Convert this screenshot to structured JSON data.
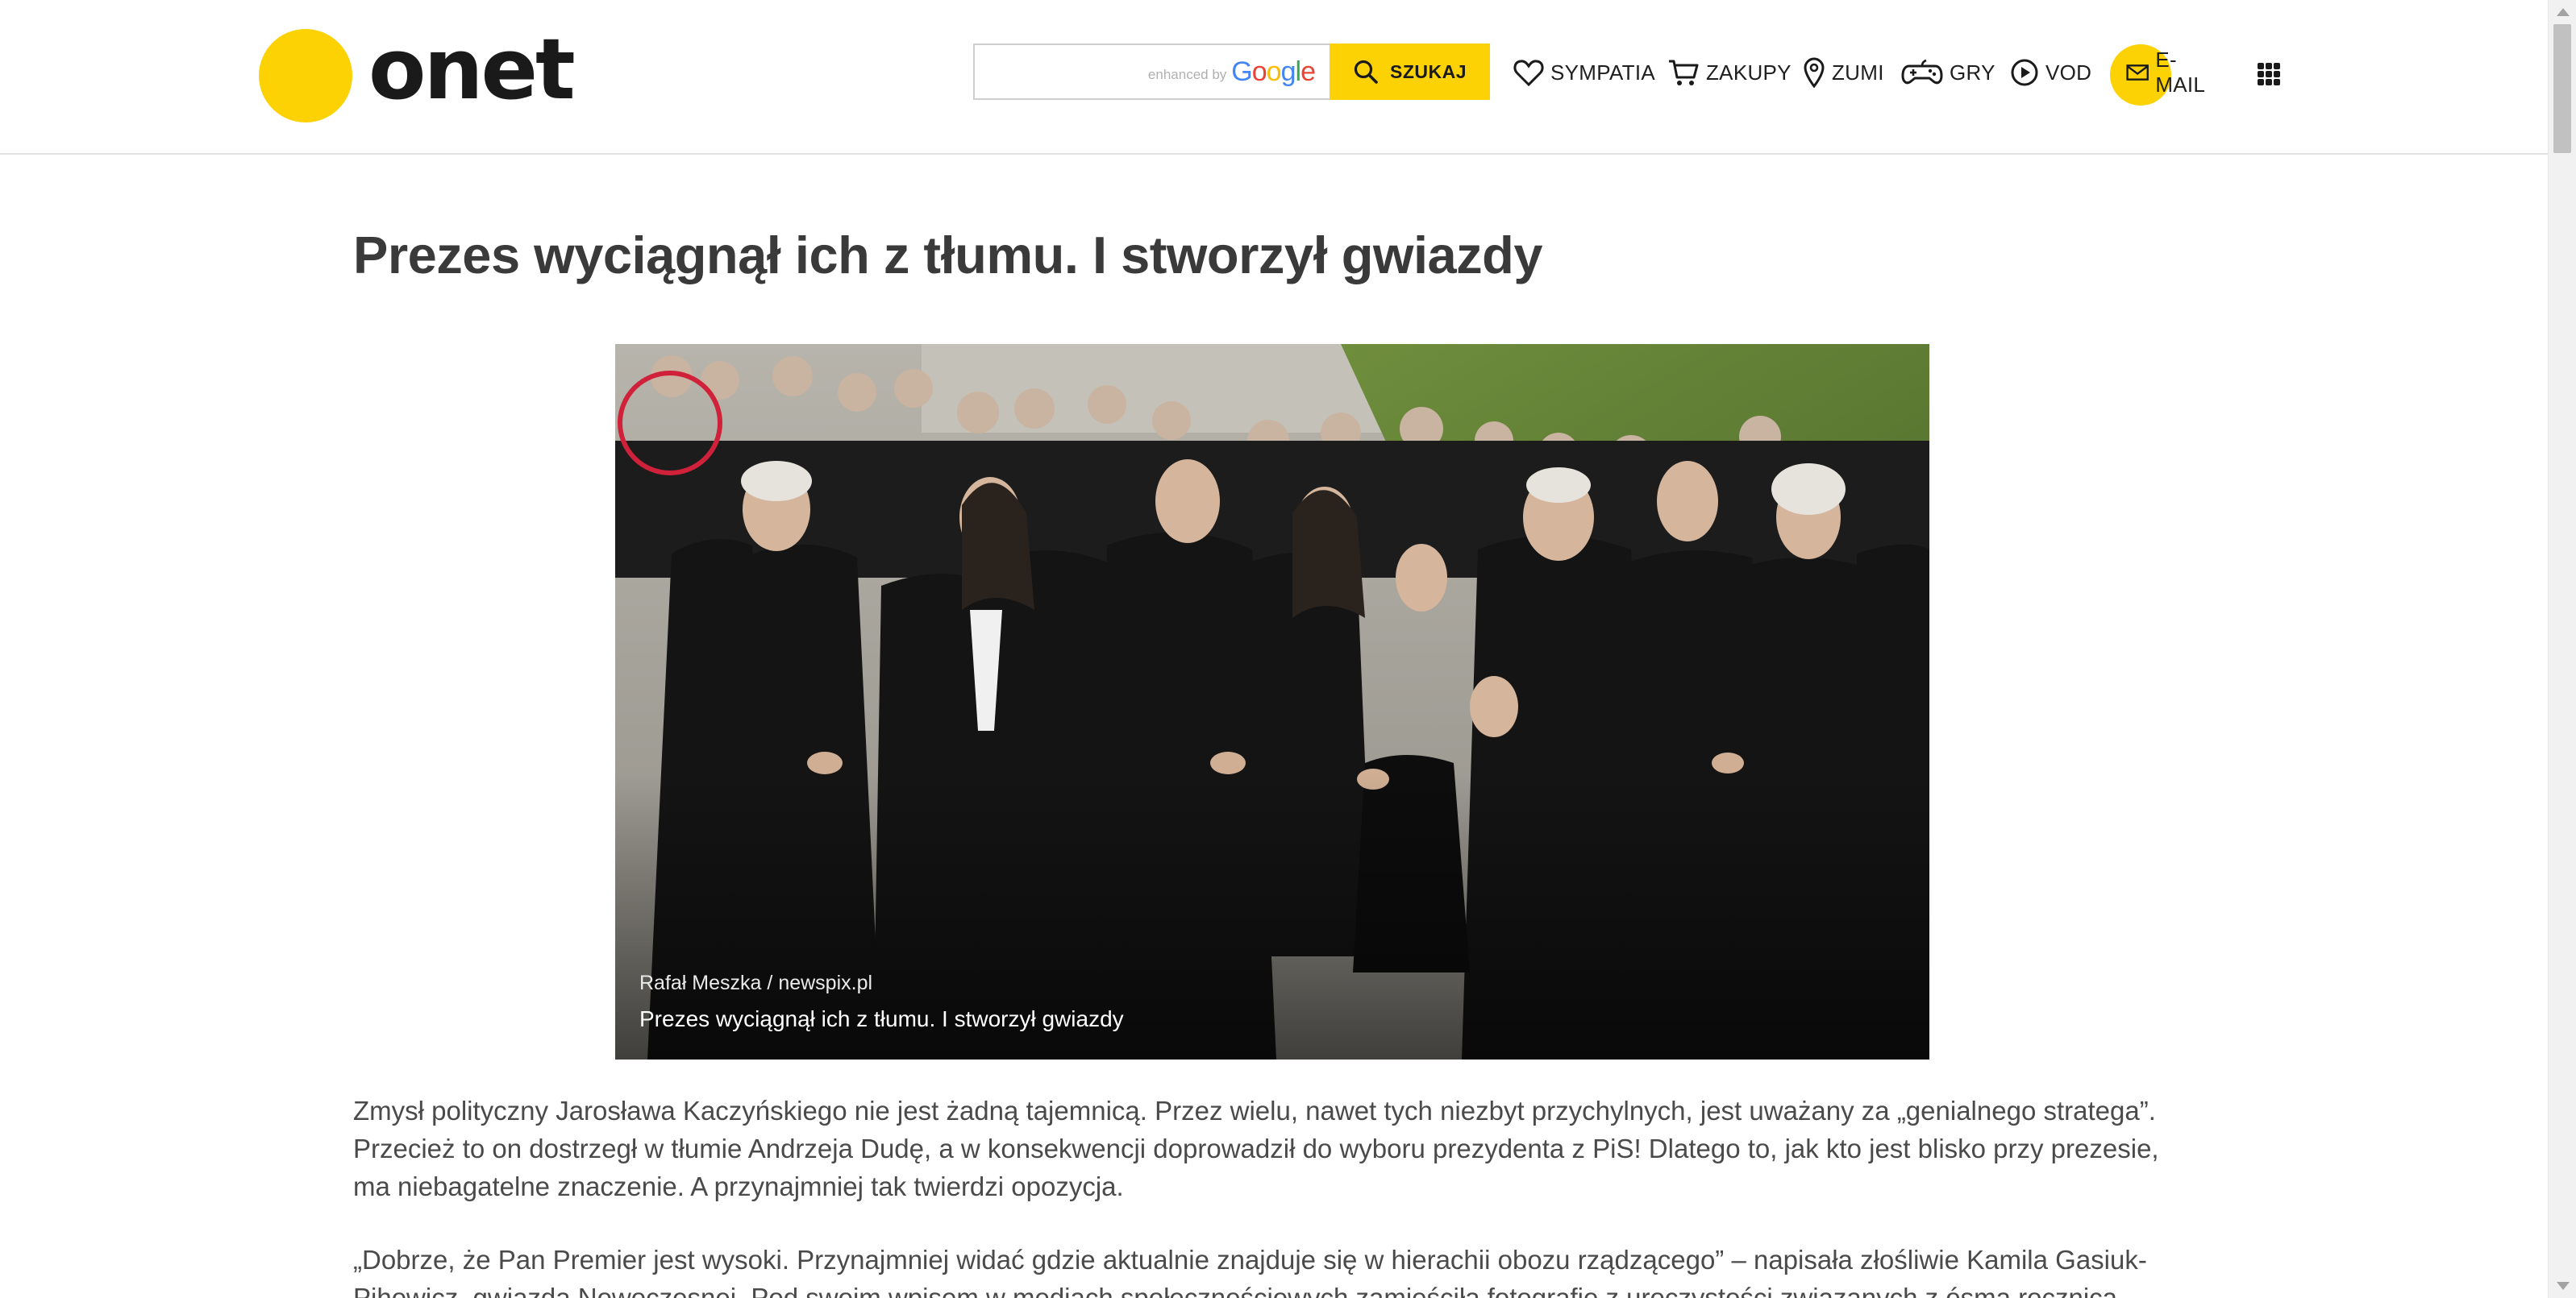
{
  "header": {
    "logo_text": "onet",
    "search": {
      "placeholder": "",
      "enhanced_by": "enhanced by",
      "google": "Google",
      "button_label": "SZUKAJ"
    },
    "nav": [
      {
        "label": "SYMPATIA",
        "icon": "heart-icon"
      },
      {
        "label": "ZAKUPY",
        "icon": "cart-icon"
      },
      {
        "label": "ZUMI",
        "icon": "map-pin-icon"
      },
      {
        "label": "GRY",
        "icon": "gamepad-icon"
      },
      {
        "label": "VOD",
        "icon": "play-icon"
      },
      {
        "label": "E-MAIL",
        "icon": "mail-icon"
      }
    ],
    "apps_icon": "apps-grid-icon"
  },
  "article": {
    "title": "Prezes wyciągnął ich z tłumu. I stworzył gwiazdy",
    "image": {
      "credit_author": "Rafał Meszka",
      "credit_separator": "/",
      "credit_agency": "newspix.pl",
      "caption": "Prezes wyciągnął ich z tłumu. I stworzył gwiazdy"
    },
    "paragraphs": [
      "Zmysł polityczny Jarosława Kaczyńskiego nie jest żadną tajemnicą. Przez wielu, nawet tych niezbyt przychylnych, jest uważany za „genialnego stratega”. Przecież to on dostrzegł w tłumie Andrzeja Dudę, a w konsekwencji doprowadził do wyboru prezydenta z PiS! Dlatego to, jak kto jest blisko przy prezesie, ma niebagatelne znaczenie. A przynajmniej tak twierdzi opozycja.",
      "„Dobrze, że Pan Premier jest wysoki. Przynajmniej widać gdzie aktualnie znajduje się w hierachii obozu rządzącego” – napisała złośliwie Kamila Gasiuk-Pihowicz, gwiazda Nowoczesnej. Pod swoim wpisem w mediach społecznościowych zamieściła fotografię z uroczystości związanych z ósmą rocznicą katastrofy smoleńskiej."
    ]
  },
  "colors": {
    "brand_yellow": "#fcd205",
    "text_dark": "#1a1a1a",
    "title": "#3a3a3a",
    "body_text": "#4a4a4a",
    "highlight_circle": "#d0213a"
  }
}
